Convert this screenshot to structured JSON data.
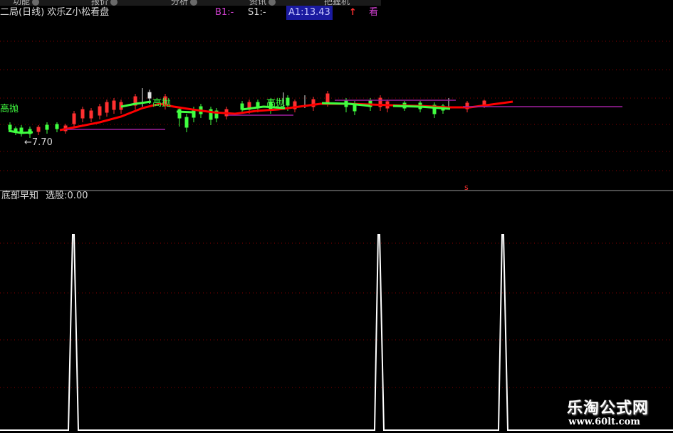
{
  "toolbar": {
    "items": [
      "功能",
      "报价",
      "分析",
      "资讯",
      "把握机"
    ]
  },
  "header": {
    "title": "二局(日线) 欢乐Z小松看盘",
    "b1": "B1:-",
    "s1": "S1:-",
    "a1": "A1:13.43",
    "a1_arrow": "↑",
    "extra": "看"
  },
  "upper_chart": {
    "label_sell_left": "高抛",
    "label_sell_2": "高抛",
    "label_sell_3": "高抛",
    "price_marker": "←7.70",
    "bottom_marker": "s"
  },
  "lower_panel": {
    "indicator_name": "底部早知",
    "field_label": "选股:0.00"
  },
  "watermark": {
    "brand": "乐淘公式网",
    "url": "www.60lt.com"
  },
  "chart_data": {
    "type": "line",
    "series": [
      {
        "values": [
          0,
          0,
          0,
          1,
          0,
          0,
          0,
          1,
          0,
          0,
          1,
          0,
          0
        ]
      }
    ],
    "ylim": [
      0,
      1
    ]
  },
  "colors": {
    "up_candle": "#ff3030",
    "down_candle": "#40ff40",
    "ma_line": "#ff0000",
    "signal_line": "#ffffff",
    "purple_line": "#a020a0",
    "grid": "#a00000"
  }
}
